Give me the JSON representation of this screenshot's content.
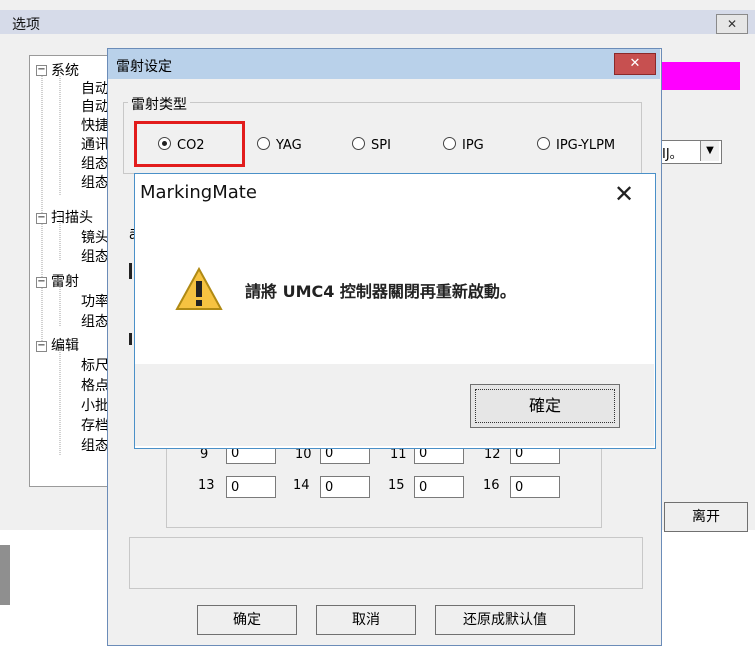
{
  "options_window": {
    "title": "选项",
    "close_glyph": "✕",
    "tree": [
      {
        "label": "系统",
        "toggle": "−"
      },
      {
        "label": "自动"
      },
      {
        "label": "自动"
      },
      {
        "label": "快捷"
      },
      {
        "label": "通讯"
      },
      {
        "label": "组态"
      },
      {
        "label": "组态"
      },
      {
        "label": "扫描头",
        "toggle": "−"
      },
      {
        "label": "镜头"
      },
      {
        "label": "组态"
      },
      {
        "label": "雷射",
        "toggle": "−"
      },
      {
        "label": "功率"
      },
      {
        "label": "组态"
      },
      {
        "label": "编辑",
        "toggle": "−"
      },
      {
        "label": "标尺"
      },
      {
        "label": "格点"
      },
      {
        "label": "小批"
      },
      {
        "label": "存档"
      },
      {
        "label": "组态"
      }
    ],
    "dropdown_value": "IJ。",
    "dropdown_arrow": "▼",
    "leave_button": "离开",
    "magenta_color": "#ff00ff"
  },
  "laser_dialog": {
    "title": "雷射设定",
    "close_glyph": "✕",
    "laser_type_label": "雷射类型",
    "laser_types": [
      {
        "label": "CO2",
        "selected": true
      },
      {
        "label": "YAG",
        "selected": false
      },
      {
        "label": "SPI",
        "selected": false
      },
      {
        "label": "IPG",
        "selected": false
      },
      {
        "label": "IPG-YLPM",
        "selected": false
      }
    ],
    "grid_row1": [
      {
        "num": "9",
        "value": "0"
      },
      {
        "num": "10",
        "value": "0"
      },
      {
        "num": "11",
        "value": "0"
      },
      {
        "num": "12",
        "value": "0"
      }
    ],
    "grid_row2": [
      {
        "num": "13",
        "value": "0"
      },
      {
        "num": "14",
        "value": "0"
      },
      {
        "num": "15",
        "value": "0"
      },
      {
        "num": "16",
        "value": "0"
      }
    ],
    "buttons": {
      "ok": "确定",
      "cancel": "取消",
      "restore": "还原成默认值"
    },
    "highlight_color": "#e21c1c"
  },
  "message_box": {
    "title": "MarkingMate",
    "close_glyph": "✕",
    "icon": "warning-icon",
    "message": "請將 UMC4 控制器關閉再重新啟動。",
    "ok_button": "確定"
  }
}
